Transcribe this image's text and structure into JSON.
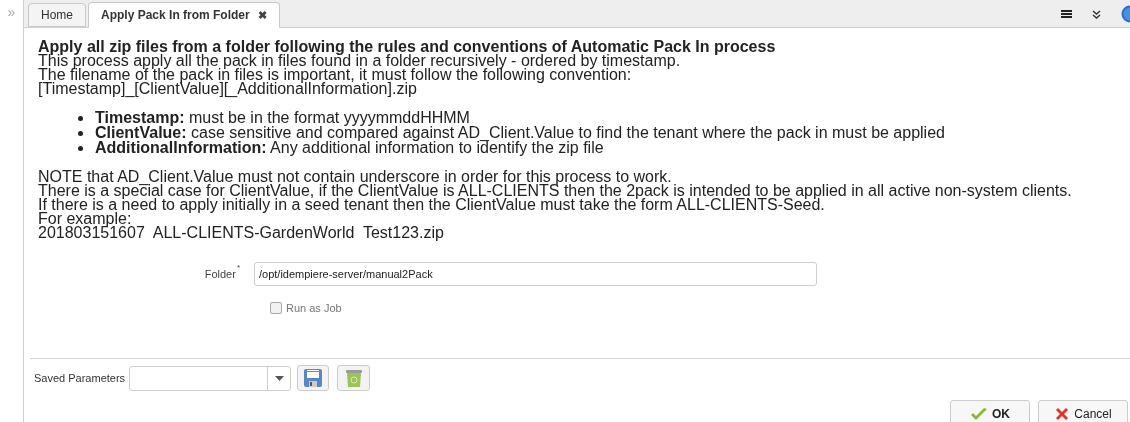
{
  "sidebar": {
    "toggle": "»"
  },
  "tabs": [
    {
      "label": "Home",
      "selected": false
    },
    {
      "label": "Apply Pack In from Folder",
      "selected": true,
      "close": "✖"
    }
  ],
  "description": {
    "title": "Apply all zip files from a folder following the rules and conventions of Automatic Pack In process",
    "intro": [
      "This process apply all the pack in files found in a folder recursively - ordered by timestamp.",
      "The filename of the pack in files is important, it must follow the following convention:",
      "[Timestamp]_[ClientValue][_AdditionalInformation].zip"
    ],
    "bullets": [
      "**Timestamp:** must be in the format yyyymmddHHMM",
      "**ClientValue:** case sensitive and compared against AD_Client.Value to find the tenant where the pack in must be applied",
      "**AdditionalInformation:** Any additional information to identify the zip file"
    ],
    "notes": [
      "NOTE that AD_Client.Value must not contain underscore in order for this process to work.",
      "There is a special case for ClientValue, if the ClientValue is ALL-CLIENTS then the 2pack is intended to be applied in all active non-system clients.",
      "If there is a need to apply initially in a seed tenant then the ClientValue must take the form ALL-CLIENTS-Seed.",
      "For example:",
      "201803151607  ALL-CLIENTS-GardenWorld  Test123.zip"
    ]
  },
  "parameters": [
    {
      "label": "Folder",
      "required_marker": "*",
      "value": "/opt/idempiere-server/manual2Pack"
    }
  ],
  "run_as_job": {
    "label": "Run as Job",
    "checked": false
  },
  "saved_parameters": {
    "label": "Saved Parameters"
  },
  "buttons": [
    {
      "kind": "ok",
      "label": "OK"
    },
    {
      "kind": "cancel",
      "label": "Cancel"
    }
  ]
}
